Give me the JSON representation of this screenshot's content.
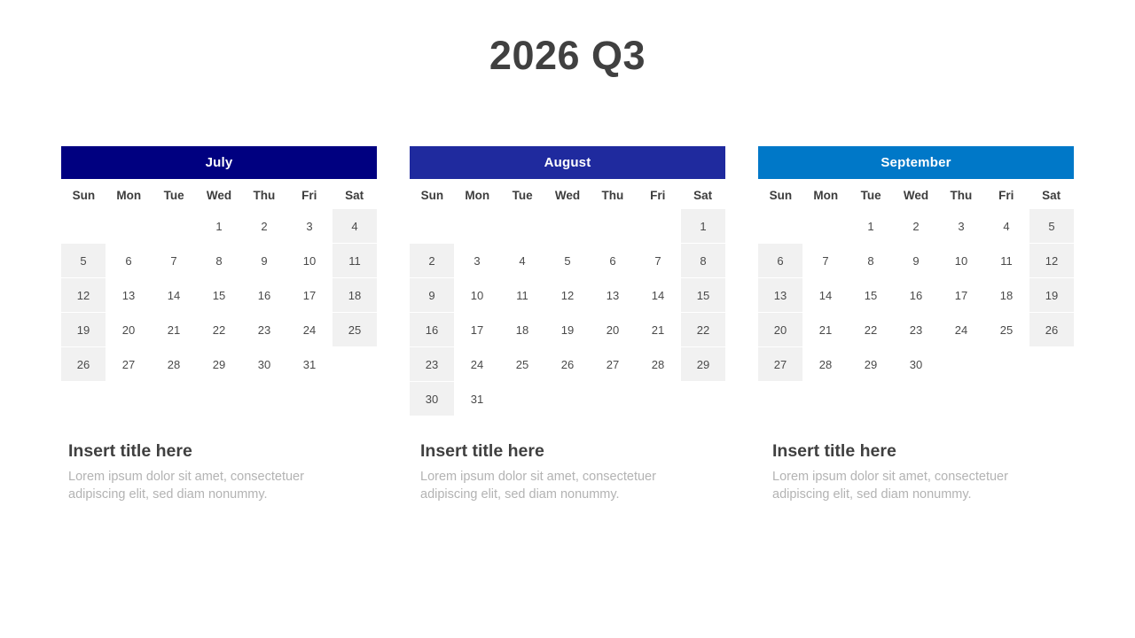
{
  "slide": {
    "title": "2026 Q3",
    "background_color": "#ffffff"
  },
  "weekday_labels": [
    "Sun",
    "Mon",
    "Tue",
    "Wed",
    "Thu",
    "Fri",
    "Sat"
  ],
  "colors": {
    "july_header": "#000080",
    "august_header": "#1f2a9e",
    "september_header": "#0078c8",
    "weekend_cell": "#f1f1f1",
    "title_text": "#404040",
    "day_text": "#4a4a4a",
    "caption_body_text": "#b3b3b3"
  },
  "months": [
    {
      "name": "July",
      "header_color": "#000080",
      "weeks": [
        [
          "",
          "",
          "",
          "1",
          "2",
          "3",
          "4"
        ],
        [
          "5",
          "6",
          "7",
          "8",
          "9",
          "10",
          "11"
        ],
        [
          "12",
          "13",
          "14",
          "15",
          "16",
          "17",
          "18"
        ],
        [
          "19",
          "20",
          "21",
          "22",
          "23",
          "24",
          "25"
        ],
        [
          "26",
          "27",
          "28",
          "29",
          "30",
          "31",
          ""
        ]
      ]
    },
    {
      "name": "August",
      "header_color": "#1f2a9e",
      "weeks": [
        [
          "",
          "",
          "",
          "",
          "",
          "",
          "1"
        ],
        [
          "2",
          "3",
          "4",
          "5",
          "6",
          "7",
          "8"
        ],
        [
          "9",
          "10",
          "11",
          "12",
          "13",
          "14",
          "15"
        ],
        [
          "16",
          "17",
          "18",
          "19",
          "20",
          "21",
          "22"
        ],
        [
          "23",
          "24",
          "25",
          "26",
          "27",
          "28",
          "29"
        ],
        [
          "30",
          "31",
          "",
          "",
          "",
          "",
          ""
        ]
      ]
    },
    {
      "name": "September",
      "header_color": "#0078c8",
      "weeks": [
        [
          "",
          "",
          "1",
          "2",
          "3",
          "4",
          "5"
        ],
        [
          "6",
          "7",
          "8",
          "9",
          "10",
          "11",
          "12"
        ],
        [
          "13",
          "14",
          "15",
          "16",
          "17",
          "18",
          "19"
        ],
        [
          "20",
          "21",
          "22",
          "23",
          "24",
          "25",
          "26"
        ],
        [
          "27",
          "28",
          "29",
          "30",
          "",
          "",
          ""
        ]
      ]
    }
  ],
  "captions": [
    {
      "title": "Insert title here",
      "body": "Lorem ipsum dolor sit amet, consectetuer adipiscing elit, sed diam nonummy."
    },
    {
      "title": "Insert title here",
      "body": "Lorem ipsum dolor sit amet, consectetuer adipiscing elit, sed diam nonummy."
    },
    {
      "title": "Insert title here",
      "body": "Lorem ipsum dolor sit amet, consectetuer adipiscing elit, sed diam nonummy."
    }
  ]
}
